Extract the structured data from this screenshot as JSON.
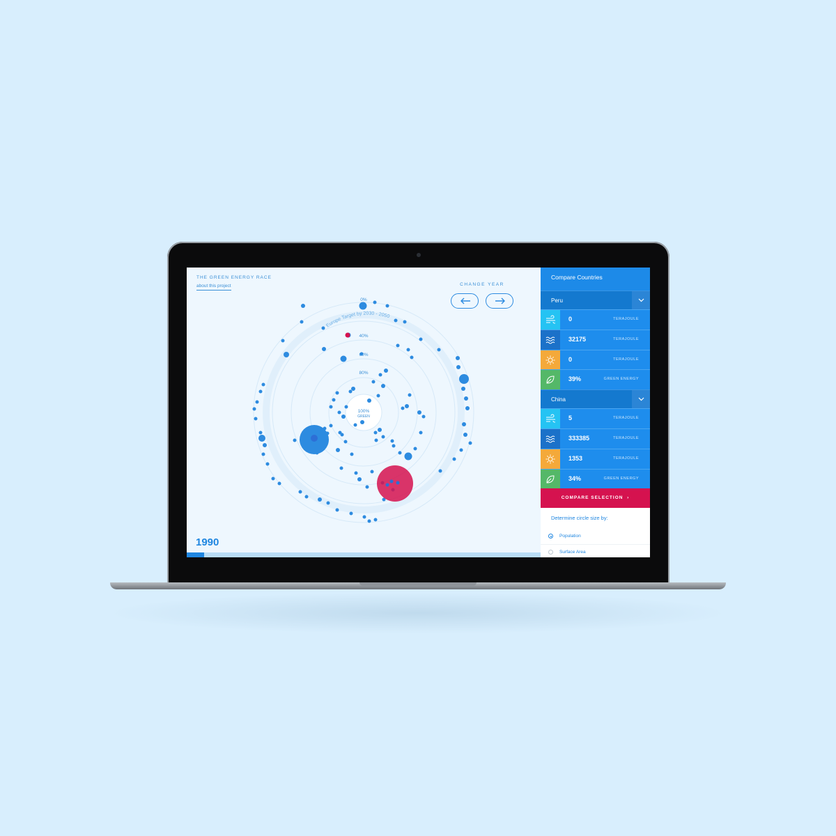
{
  "app": {
    "title": "THE GREEN ENERGY RACE",
    "about_link": "about this project"
  },
  "controls": {
    "change_year_label": "CHANGE YEAR",
    "prev_icon": "arrow-left-icon",
    "next_icon": "arrow-right-icon"
  },
  "timeline": {
    "year": "1990",
    "progress_fraction": 0.05
  },
  "viz": {
    "ring_labels": [
      "0%",
      "40%",
      "60%",
      "80%"
    ],
    "center_label_1": "100%",
    "center_label_2": "GREEN",
    "target_arc_label": "Europe Target by 2030 - 2050",
    "colors": {
      "dot": "#2d8be0",
      "highlight": "#d5124f"
    }
  },
  "panel": {
    "header": "Compare Countries",
    "countries": [
      {
        "name": "Peru",
        "metrics": [
          {
            "icon": "wind-icon",
            "color": "#25c3f3",
            "value": "0",
            "unit": "TERAJOULE"
          },
          {
            "icon": "water-icon",
            "color": "#1b71c9",
            "value": "32175",
            "unit": "TERAJOULE"
          },
          {
            "icon": "sun-icon",
            "color": "#f4a93a",
            "value": "0",
            "unit": "TERAJOULE"
          },
          {
            "icon": "leaf-icon",
            "color": "#54b868",
            "value": "39%",
            "unit": "GREEN ENERGY"
          }
        ]
      },
      {
        "name": "China",
        "metrics": [
          {
            "icon": "wind-icon",
            "color": "#25c3f3",
            "value": "5",
            "unit": "TERAJOULE"
          },
          {
            "icon": "water-icon",
            "color": "#1b71c9",
            "value": "333385",
            "unit": "TERAJOULE"
          },
          {
            "icon": "sun-icon",
            "color": "#f4a93a",
            "value": "1353",
            "unit": "TERAJOULE"
          },
          {
            "icon": "leaf-icon",
            "color": "#54b868",
            "value": "34%",
            "unit": "GREEN ENERGY"
          }
        ]
      }
    ],
    "compare_button": "COMPARE SELECTION",
    "size_label": "Determine circle size by:",
    "size_options": [
      {
        "label": "Population",
        "selected": true
      },
      {
        "label": "Surface Area",
        "selected": false
      }
    ]
  }
}
